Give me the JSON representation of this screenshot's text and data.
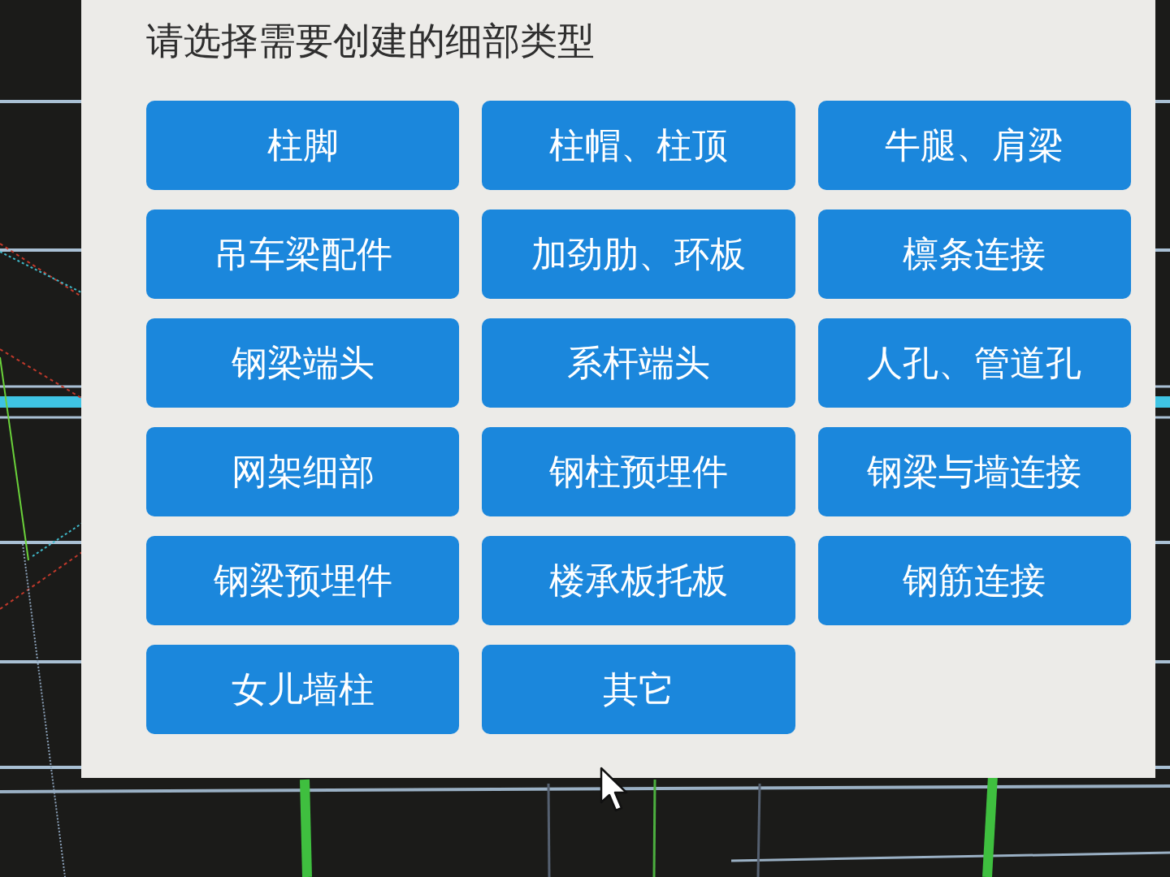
{
  "dialog": {
    "title": "请选择需要创建的细部类型",
    "options": [
      "柱脚",
      "柱帽、柱顶",
      "牛腿、肩梁",
      "吊车梁配件",
      "加劲肋、环板",
      "檩条连接",
      "钢梁端头",
      "系杆端头",
      "人孔、管道孔",
      "网架细部",
      "钢柱预埋件",
      "钢梁与墙连接",
      "钢梁预埋件",
      "楼承板托板",
      "钢筋连接",
      "女儿墙柱",
      "其它"
    ]
  }
}
